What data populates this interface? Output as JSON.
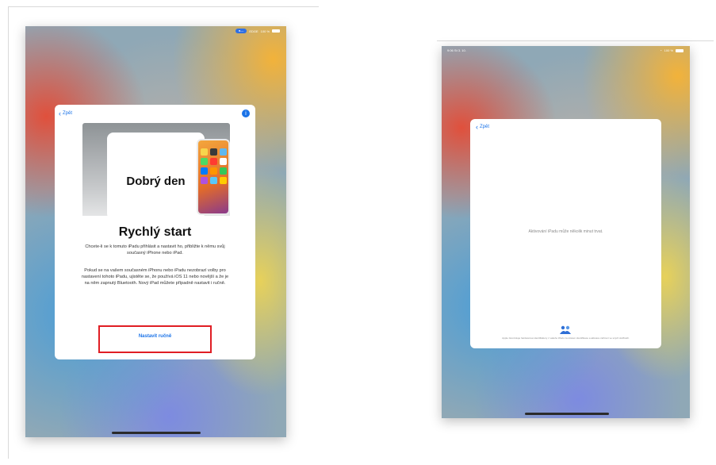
{
  "left_screen": {
    "status": {
      "pill": "●—",
      "carrier": "EDGE",
      "battery": "100 %"
    },
    "card": {
      "back_label": "Zpět",
      "info_icon": "info-icon",
      "greeting": "Dobrý den",
      "title": "Rychlý start",
      "paragraph1": "Chcete-li se k tomuto iPadu přihlásit a nastavit ho, přibližte k němu svůj současný iPhone nebo iPad.",
      "paragraph2": "Pokud se na vašem současném iPhonu nebo iPadu nezobrazí volby pro nastavení tohoto iPadu, ujistěte se, že používá iOS 11 nebo novější a že je na něm zapnutý Bluetooth. Nový iPad můžete případně nastavit i ručně.",
      "manual_button": "Nastavit ručně"
    },
    "highlight_color": "#e01e24"
  },
  "right_screen": {
    "status": {
      "time": "9:06",
      "date": "St 3. 10.",
      "battery": "100 %"
    },
    "card": {
      "back_label": "Zpět",
      "activating_text": "Aktivování iPadu může několik minut trvat.",
      "privacy_icon": "privacy-handshake-icon",
      "privacy_text": "Apple zkontroluje hardwarové identifikátory z vašeho iPadu za účelem identifikace a aktivace zařízení ve svých službách."
    },
    "accent_color": "#1a73e8"
  }
}
